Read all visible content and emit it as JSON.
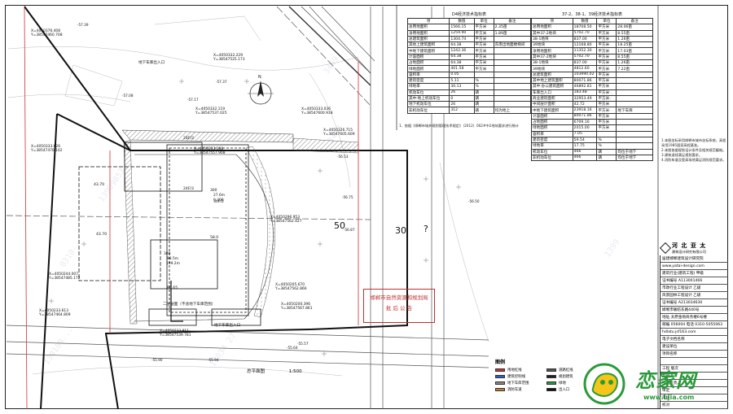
{
  "drawing": {
    "scale_title": "总平面图",
    "scale": "1:500",
    "compass_label": "N",
    "road_labels": [
      "50",
      "30",
      "?"
    ],
    "elevations": [
      "-57.39",
      "-57.37",
      "-57.17",
      "-57.08",
      "-56.53",
      "-56.75",
      "-56.87",
      "-55.94",
      "-55.90",
      "-55.64",
      "-55.57",
      "-56.50"
    ],
    "coords": [
      "X=4050376.408\nY=38547460.708",
      "X=4050332.229\nY=38547525.173",
      "X=4050332.119\nY=38547537.025",
      "X=4050333.036\nY=38547600.918",
      "X=4050326.715\nY=38547605.609",
      "X=4050333.626\nY=38547470.102",
      "X=4050233.168\nY=38547557.908",
      "X=4050296.953\nY=38547562.427",
      "X=4050244.007\nY=38547485.172",
      "X=4050205.670\nY=38547562.866",
      "X=4050200.396\nY=38547567.861",
      "X=4050233.613\nY=38547464.809",
      "X=4050233.811\nY=38547539.781"
    ],
    "building_labels": [
      "24F/3",
      "58.0",
      "43.70",
      "43.70",
      "80.65",
      "24F/3",
      "30F/2",
      "二层层面（不含地下车库范围）",
      "地下车库出入口",
      "地下车库出入口"
    ],
    "dimension_labels": [
      "300",
      "27.6m",
      "0.300",
      "300",
      "98.5m",
      "199.2m"
    ],
    "overlay_stamp": [
      "邯郸市自然资源和规划局",
      "批 后 公 告"
    ]
  },
  "table_a": {
    "caption": "D4经济技术指标表",
    "headers": [
      "项",
      "数值",
      "单位",
      "备注"
    ],
    "rows": [
      [
        "总用地面积",
        "1566.15",
        "平方米",
        "2.35亩"
      ],
      [
        "净用地面积",
        "1259.90",
        "平方米",
        "1.89亩"
      ],
      [
        "总建筑面积",
        "1304.74",
        "平方米",
        ""
      ],
      [
        "其他上建筑面积",
        "64.38",
        "平方米",
        "东南出地面楼梯间"
      ],
      [
        "中地下建筑面积",
        "1242.36",
        "平方米",
        ""
      ],
      [
        "计容面积",
        "64.38",
        "平方米",
        ""
      ],
      [
        "占地面积",
        "64.38",
        "平方米",
        ""
      ],
      [
        "绿地面积",
        "401.58",
        "平方米",
        ""
      ],
      [
        "容积率",
        "0.05",
        "",
        ""
      ],
      [
        "建筑密度",
        "5.11",
        "%",
        ""
      ],
      [
        "绿地率",
        "30.13",
        "%",
        ""
      ],
      [
        "机动车位",
        "26",
        "辆",
        ""
      ],
      [
        "其中:地上机动车位",
        "0",
        "辆",
        ""
      ],
      [
        "地下机动车位",
        "26",
        "辆",
        ""
      ],
      [
        "非机动车位",
        "312",
        "辆",
        "均为地上"
      ]
    ],
    "footnote": "1、依据《邯郸市城乡规划管理技术规定》（2012）002#中2地块要求进行统计"
  },
  "table_b": {
    "caption": "37-2、38-1、39经济技术指标表",
    "headers": [
      "项",
      "数值",
      "单位",
      "备注"
    ],
    "rows": [
      [
        "总用地面积",
        "18708.50",
        "平方米",
        "28.06亩"
      ],
      [
        "其中37-2地块",
        "5702.70",
        "平方米",
        "8.55亩"
      ],
      [
        "38-1地块",
        "837.00",
        "平方米",
        "1.26亩"
      ],
      [
        "39地块",
        "12168.80",
        "平方米",
        "18.25亩"
      ],
      [
        "净用地面积",
        "11352.30",
        "平方米",
        "17.03亩"
      ],
      [
        "其中37-2地块",
        "5702.70",
        "平方米",
        "8.55亩"
      ],
      [
        "38-1地块",
        "837.00",
        "平方米",
        "1.26亩"
      ],
      [
        "39地块",
        "4812.60",
        "平方米",
        "7.22亩"
      ],
      [
        "总建筑面积",
        "103990.02",
        "平方米",
        ""
      ],
      [
        "其中地上建筑面积",
        "80071.86",
        "平方米",
        ""
      ],
      [
        "其中:办公建筑面积",
        "46892.81",
        "平方米",
        ""
      ],
      [
        "车库出入口",
        "183.48",
        "平方米",
        ""
      ],
      [
        "商业建筑面积",
        "32953.49",
        "平方米",
        ""
      ],
      [
        "中间层计面积",
        "42.72",
        "平方米",
        ""
      ],
      [
        "中地下建筑面积",
        "23918.16",
        "平方米",
        "地下车库"
      ],
      [
        "计容面积",
        "80071.86",
        "平方米",
        ""
      ],
      [
        "占地面积",
        "6709.16",
        "平方米",
        ""
      ],
      [
        "绿地面积",
        "2015.00",
        "平方米",
        ""
      ],
      [
        "容积率",
        "7.05",
        "",
        ""
      ],
      [
        "建筑密度",
        "59.54",
        "%",
        ""
      ],
      [
        "绿地率",
        "17.75",
        "%",
        ""
      ],
      [
        "机动车位",
        "466",
        "辆",
        "均位于地下"
      ],
      [
        "非机动车位",
        "466",
        "辆",
        "均位于地下"
      ]
    ]
  },
  "notes": [
    "1.本图坐标采用邯郸市城市坐标系统，高程",
    "采用1985国家高程基准。",
    "2.本图依据规划设计条件及相关规范编制。",
    "3.建筑退线满足规划要求。",
    "4.消防车道及登高场地满足消防规范要求。"
  ],
  "title_block": {
    "company_name": "河 北 亚 太",
    "company_sub": "建筑设计研究有限公司",
    "rows": [
      "居建邯郸建筑设计研究院",
      "www.yatai-design.com",
      "建筑行业(建筑工程)    甲级",
      "证书编号    A113001466",
      "市政行业工程设计    乙级",
      "风景园林工程设计    乙级",
      "证书编号    A213034630",
      "邯郸市联纺东路440号",
      "地址    太原金地商务楼6号楼",
      "邮编  056004   电话  0310-5055063",
      "hdlatu.jsf163.com",
      "电子文档名称",
      "建设单位",
      "项目名称",
      "",
      "工程            版次",
      "专业            A",
      "项目负责人",
      "审定",
      "审核",
      "校对"
    ]
  },
  "legend": {
    "title": "图例",
    "items": [
      "用地红线",
      "道路红线",
      "建筑控制线",
      "规划建筑",
      "地下车库范围",
      "绿地",
      "消防车道",
      "出入口"
    ]
  },
  "brand": {
    "name": "恋家网",
    "url": "www.Ljia.com"
  },
  "watermarks": [
    "13909853...",
    "0310-",
    "3469",
    "3463",
    "130109...",
    "17034 27",
    "0317...",
    "1399",
    "1290317"
  ],
  "colors": {
    "line": "#1a1a1a",
    "road": "#555555",
    "red": "#d03030",
    "hatch": "#333333",
    "brand_green": "#2a9a3a"
  }
}
